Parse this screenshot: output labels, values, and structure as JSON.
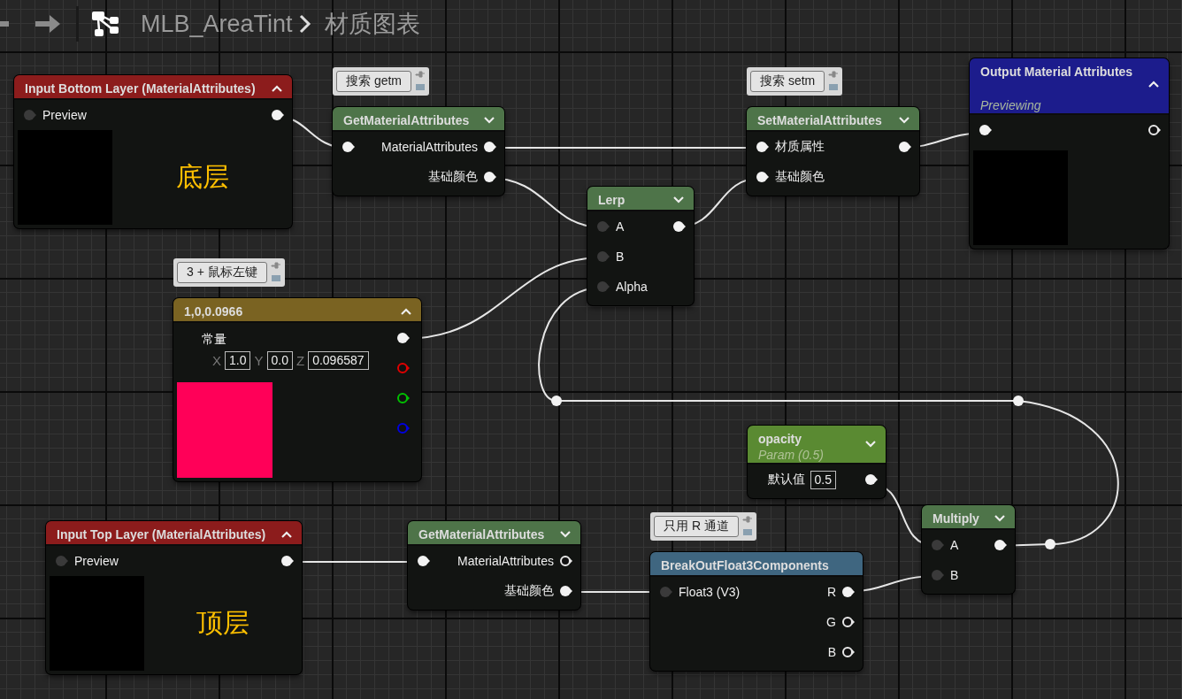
{
  "breadcrumb": {
    "asset": "MLB_AreaTint",
    "graph": "材质图表"
  },
  "nodes": [
    {
      "kind": "input",
      "title": "Input Bottom Layer (MaterialAttributes)",
      "color": "#8c1c1c",
      "expanded": true,
      "rows": [
        {
          "in": {
            "label": "Preview",
            "connected": false
          },
          "out": {
            "connected": true
          }
        }
      ],
      "caption": "底层"
    },
    {
      "kind": "function",
      "title": "GetMaterialAttributes",
      "color": "#4e7449",
      "expanded": false,
      "comment": "搜索 getm",
      "rows": [
        {
          "in": {
            "connected": true
          },
          "out": {
            "label": "MaterialAttributes",
            "connected": true
          }
        },
        {
          "out": {
            "label": "基础颜色",
            "connected": true
          }
        }
      ]
    },
    {
      "kind": "function",
      "title": "SetMaterialAttributes",
      "color": "#4e7449",
      "expanded": false,
      "comment": "搜索 setm",
      "rows": [
        {
          "in": {
            "label": "材质属性",
            "connected": true
          },
          "out": {
            "connected": true
          }
        },
        {
          "in": {
            "label": "基础颜色",
            "connected": true
          }
        }
      ]
    },
    {
      "kind": "output",
      "title": "Output Material Attributes",
      "subtitle": "Previewing",
      "color": "#1c1c8c",
      "expanded": true,
      "rows": [
        {
          "in": {
            "connected": true
          },
          "out": {
            "connected": false
          }
        }
      ]
    },
    {
      "kind": "function",
      "title": "Lerp",
      "color": "#4e7449",
      "expanded": false,
      "rows": [
        {
          "in": {
            "label": "A",
            "connected": false
          },
          "out": {
            "connected": true
          }
        },
        {
          "in": {
            "label": "B",
            "connected": false
          }
        },
        {
          "in": {
            "label": "Alpha",
            "connected": false
          }
        }
      ]
    },
    {
      "kind": "constant",
      "title": "1,0,0.0966",
      "color": "#7a6322",
      "expanded": true,
      "comment": "3 + 鼠标左键",
      "label": "常量",
      "fields": [
        {
          "name": "X",
          "value": "1.0"
        },
        {
          "name": "Y",
          "value": "0.0"
        },
        {
          "name": "Z",
          "value": "0.096587"
        }
      ],
      "outputs": [
        {
          "connected": true
        },
        {
          "connected": false,
          "color": "#e00000"
        },
        {
          "connected": false,
          "color": "#00c000"
        },
        {
          "connected": false,
          "color": "#0000e0"
        }
      ]
    },
    {
      "kind": "param",
      "title": "opacity",
      "subtitle": "Param (0.5)",
      "color": "#5a8a32",
      "expanded": false,
      "rows": [
        {
          "field": {
            "name": "默认值",
            "value": "0.5"
          },
          "out": {
            "connected": true
          }
        }
      ]
    },
    {
      "kind": "function",
      "title": "Multiply",
      "color": "#4e7449",
      "expanded": false,
      "rows": [
        {
          "in": {
            "label": "A",
            "connected": false
          },
          "out": {
            "connected": true
          }
        },
        {
          "in": {
            "label": "B",
            "connected": false
          }
        }
      ]
    },
    {
      "kind": "input",
      "title": "Input Top Layer (MaterialAttributes)",
      "color": "#8c1c1c",
      "expanded": true,
      "rows": [
        {
          "in": {
            "label": "Preview",
            "connected": false
          },
          "out": {
            "connected": true
          }
        }
      ],
      "caption": "顶层"
    },
    {
      "kind": "function",
      "title": "GetMaterialAttributes",
      "color": "#4e7449",
      "expanded": false,
      "rows": [
        {
          "in": {
            "connected": true
          },
          "out": {
            "label": "MaterialAttributes",
            "connected": false
          }
        },
        {
          "out": {
            "label": "基础颜色",
            "connected": true
          }
        }
      ]
    },
    {
      "kind": "function",
      "title": "BreakOutFloat3Components",
      "color": "#3f6680",
      "comment": "只用 R 通道",
      "rows": [
        {
          "in": {
            "label": "Float3 (V3)",
            "connected": false
          },
          "out": {
            "label": "R",
            "connected": true
          }
        },
        {
          "out": {
            "label": "G",
            "connected": false
          }
        },
        {
          "out": {
            "label": "B",
            "connected": false
          }
        }
      ]
    }
  ]
}
